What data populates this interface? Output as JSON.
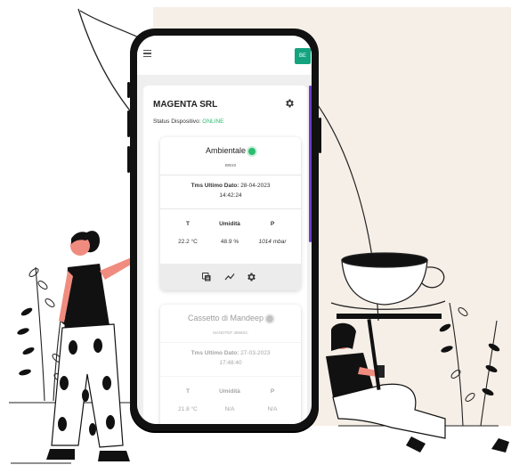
{
  "app": {
    "company": "MAGENTA SRL",
    "status_label": "Status Dispositivo:",
    "status_value": "ONLINE",
    "user_initials": "BE"
  },
  "colors": {
    "accent": "#14a37f",
    "online": "#2bbd6e",
    "scroll": "#6b3fc8"
  },
  "icons": [
    "menu-icon",
    "gear-icon",
    "copy-icon",
    "chart-line-icon",
    "gear-icon",
    "status-dot-icon"
  ],
  "devices": [
    {
      "name": "Ambientale",
      "code": "ENV3",
      "status_color": "#2bbd6e",
      "last_label": "Tms Ultimo Dato:",
      "last_date": "28-04-2023",
      "last_time": "14:42:24",
      "headers": [
        "T",
        "Umidità",
        "P"
      ],
      "values": [
        "22.2 °C",
        "48.9 %",
        "1014 mbar"
      ]
    },
    {
      "name": "Cassetto di Mandeep",
      "code": "MANDTEP 3858SC",
      "status_color": "#7a7a7a",
      "last_label": "Tms Ultimo Dato:",
      "last_date": "27-03-2023",
      "last_time": "17:48:40",
      "headers": [
        "T",
        "Umidità",
        "P"
      ],
      "values": [
        "21.8 °C",
        "N/A",
        "N/A"
      ]
    }
  ]
}
